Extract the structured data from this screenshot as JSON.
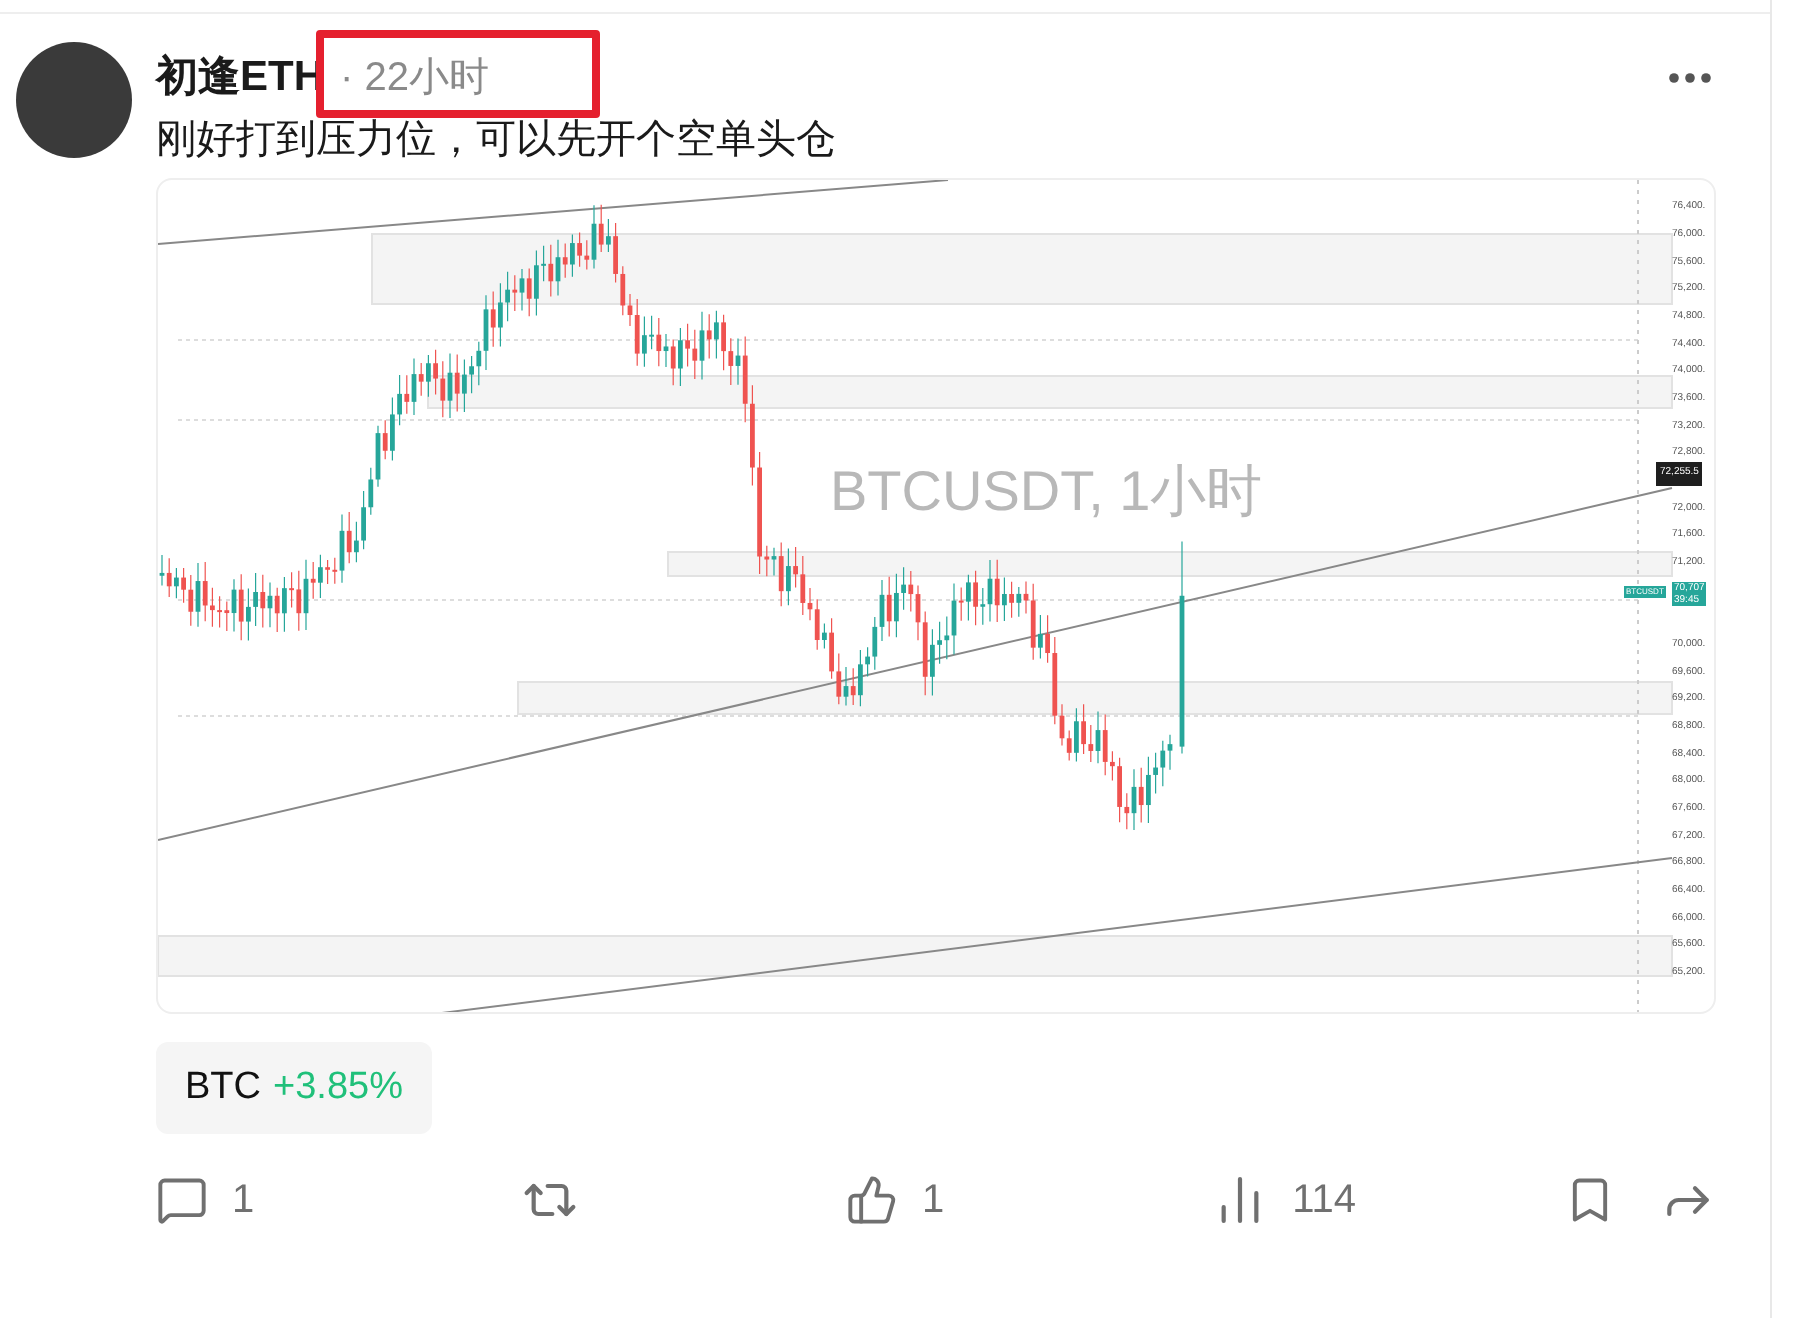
{
  "post": {
    "author": "初逢ETH",
    "time": "· 22小时",
    "text": "刚好打到压力位，可以先开个空单头仓"
  },
  "chart_image": {
    "watermark": "BTCUSDT, 1小时",
    "price_labels": [
      "76,400.",
      "76,000.",
      "75,600.",
      "75,200.",
      "74,800.",
      "74,400.",
      "74,000.",
      "73,600.",
      "73,200.",
      "72,800.",
      "72,000.",
      "71,600.",
      "71,200.",
      "70,000.",
      "69,600.",
      "69,200.",
      "68,800.",
      "68,400.",
      "68,000.",
      "67,600.",
      "67,200.",
      "66,800.",
      "66,400.",
      "66,000.",
      "65,600.",
      "65,200."
    ],
    "last_price_tag": "72,255.5",
    "symbol_tag": "BTCUSDT",
    "price_tag": "70,707",
    "countdown": "39:45"
  },
  "ticker": {
    "symbol": "BTC",
    "change": "+3.85%"
  },
  "actions": [
    {
      "kind": "comment",
      "count": "1"
    },
    {
      "kind": "repost"
    },
    {
      "kind": "like",
      "count": "1"
    },
    {
      "kind": "views",
      "count": "114"
    },
    {
      "kind": "bookmark"
    },
    {
      "kind": "share"
    }
  ]
}
